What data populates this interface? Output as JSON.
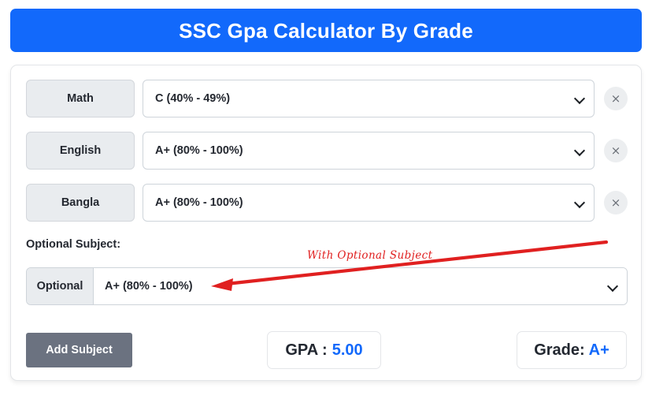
{
  "header": {
    "title": "SSC Gpa Calculator By Grade",
    "accent_color": "#1269fb"
  },
  "subjects": [
    {
      "name": "Math",
      "grade": "C (40% - 49%)",
      "remove_icon": "close-icon",
      "remove_glyph": "×",
      "chevron_icon": "chevron-down-icon"
    },
    {
      "name": "English",
      "grade": "A+ (80% - 100%)",
      "remove_icon": "close-icon",
      "remove_glyph": "×",
      "chevron_icon": "chevron-down-icon"
    },
    {
      "name": "Bangla",
      "grade": "A+ (80% - 100%)",
      "remove_icon": "close-icon",
      "remove_glyph": "×",
      "chevron_icon": "chevron-down-icon"
    }
  ],
  "optional": {
    "section_label": "Optional Subject:",
    "tag": "Optional",
    "grade": "A+ (80% - 100%)",
    "chevron_icon": "chevron-down-icon"
  },
  "annotation": {
    "text": "With Optional Subject",
    "color": "#e02020",
    "arrow_icon": "arrow-left-icon"
  },
  "actions": {
    "add_subject_label": "Add Subject",
    "add_subject_color": "#6b7280"
  },
  "results": {
    "gpa_label": "GPA :",
    "gpa_value": "5.00",
    "grade_label": "Grade:",
    "grade_value": "A+",
    "value_color": "#1269fb"
  }
}
